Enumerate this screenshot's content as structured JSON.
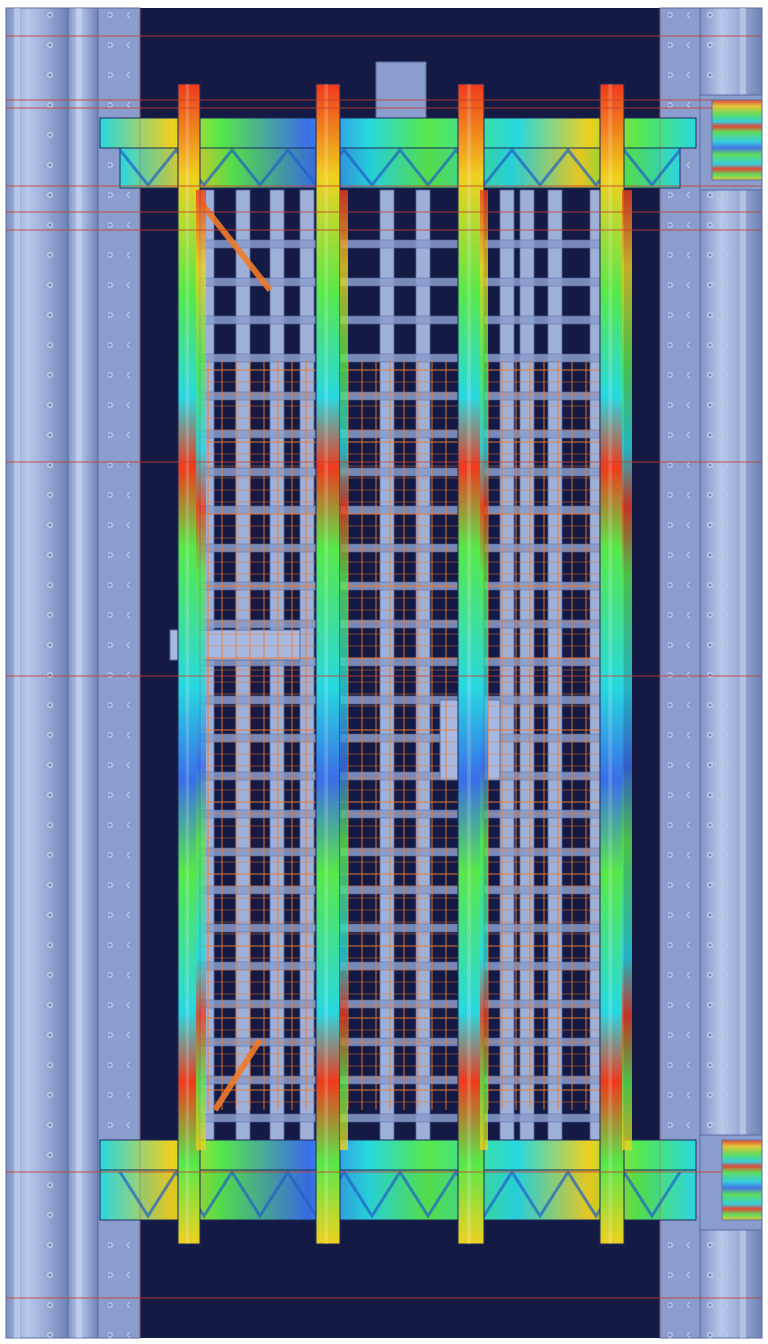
{
  "view": {
    "render_mode": "fea-stress-contour",
    "palette": {
      "background": "#141a44",
      "frame_steel": "#9fb0d8",
      "frame_shadow": "#6f82b4",
      "frame_highlight": "#c9d6f2",
      "mesh_orange": "#f07a2a",
      "guide_red": "#c8402c",
      "contour_low": "#3a6ee8",
      "contour_mid_low": "#28d8e0",
      "contour_mid": "#58e84a",
      "contour_mid_high": "#f0d020",
      "contour_high": "#f03a1c"
    }
  }
}
